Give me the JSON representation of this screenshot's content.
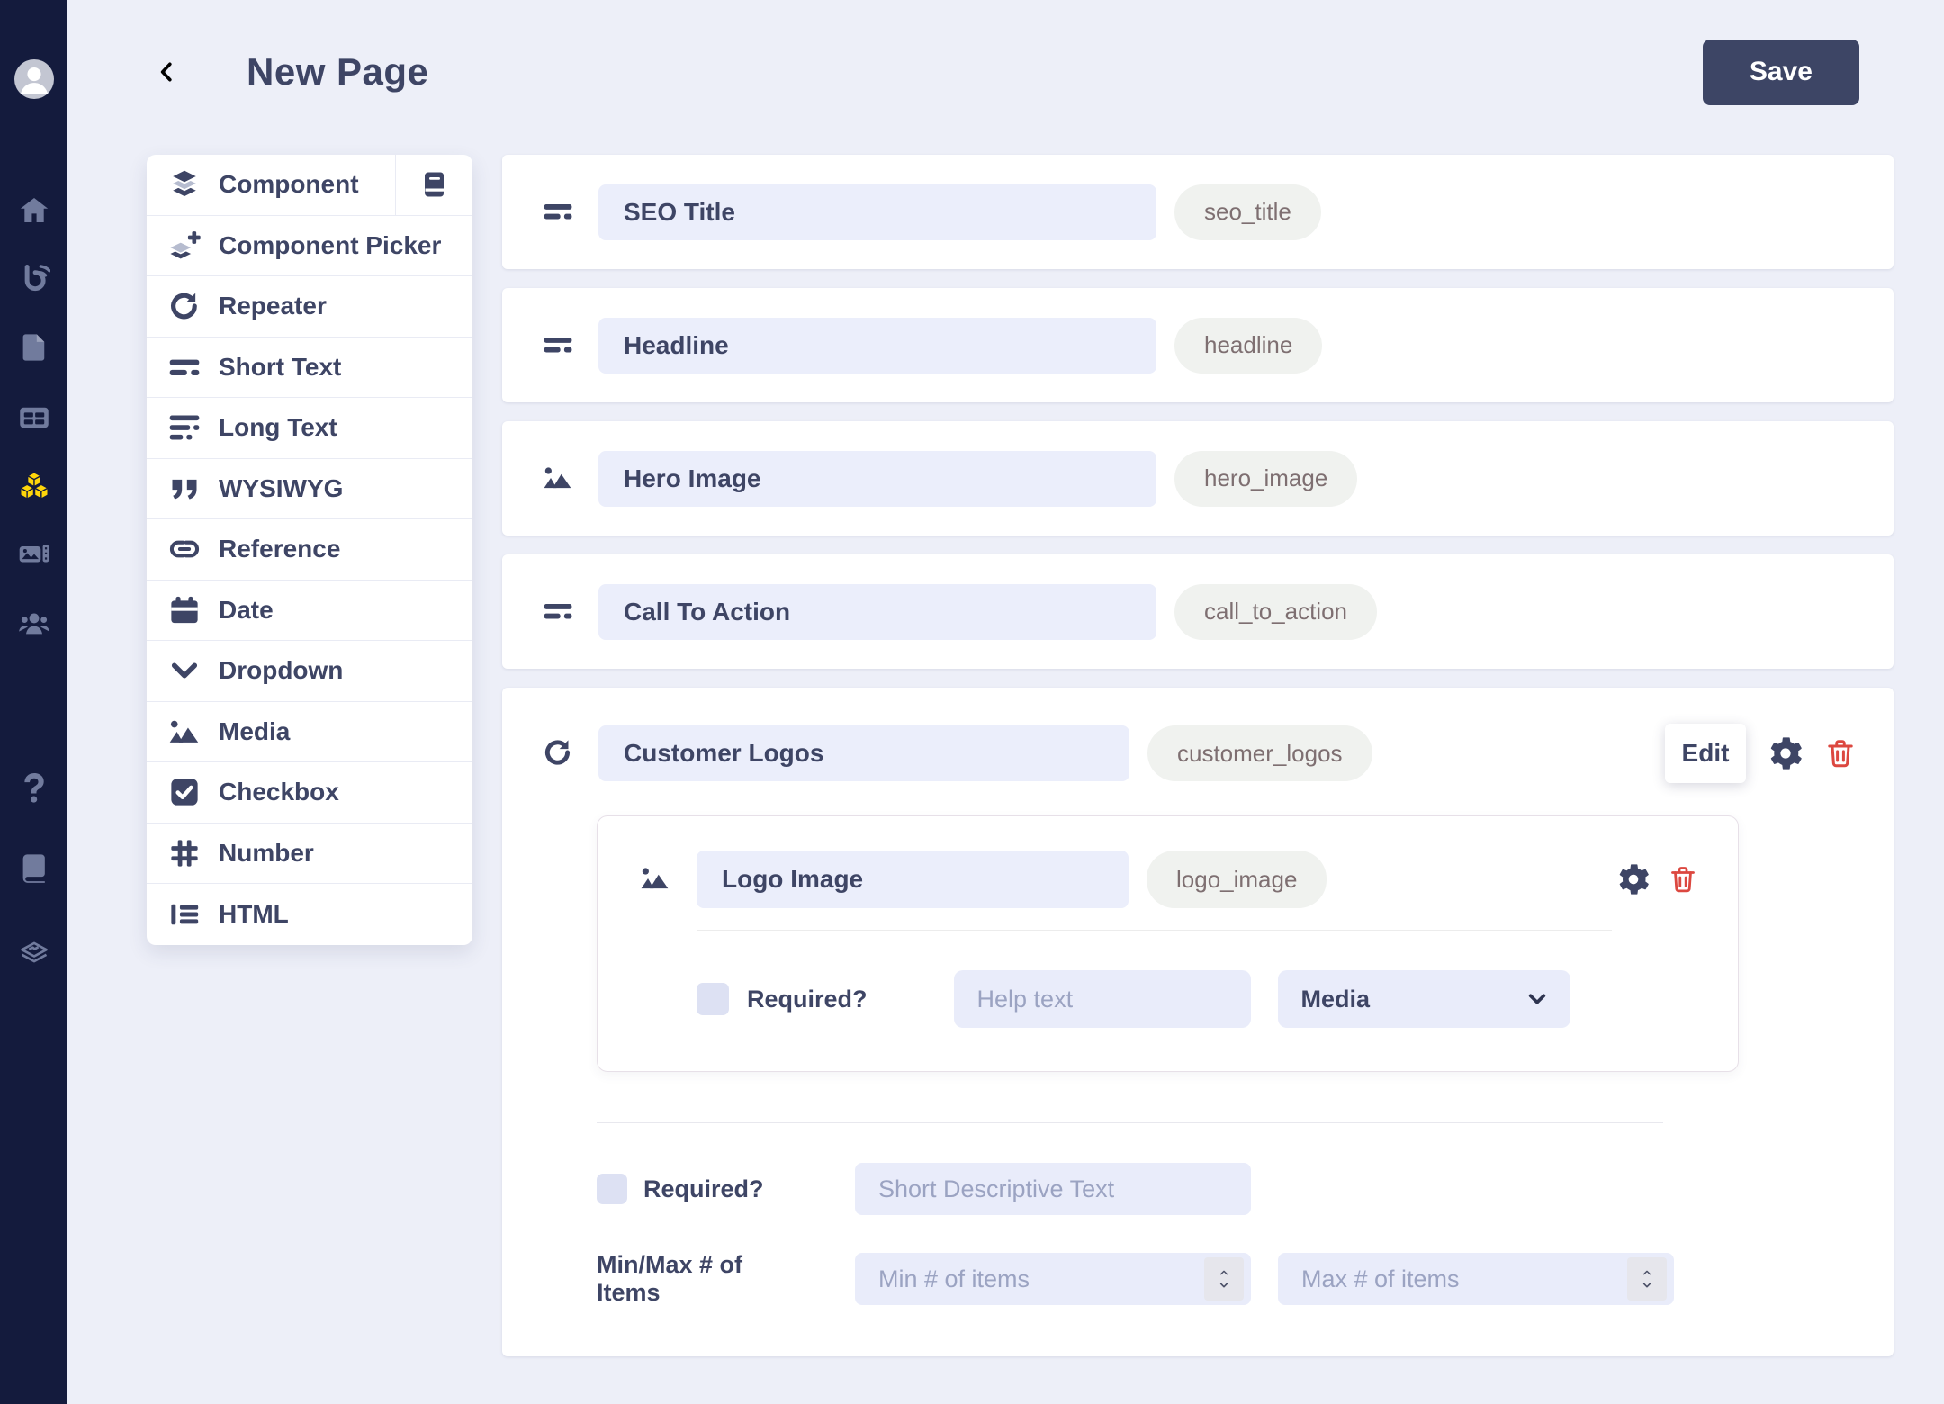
{
  "colors": {
    "accent_yellow": "#FFD60A",
    "sidebar_bg": "#141B3D",
    "primary_dark": "#3E4565",
    "danger_red": "#DC4840",
    "page_bg": "#EDEFF8",
    "input_bg": "#EBEEFB",
    "badge_bg": "#F0F2EF",
    "badge_text": "#7E6F71"
  },
  "header": {
    "title": "New Page",
    "save_label": "Save"
  },
  "sidebar": {
    "items": [
      "avatar",
      "home",
      "blog",
      "pages",
      "collections",
      "components (active)",
      "media-library",
      "users",
      "help",
      "docs",
      "stack"
    ]
  },
  "icons": {
    "avatar-icon": "person silhouette in circle",
    "home-icon": "house",
    "blog-icon": "letter b with broadcast waves",
    "pages-icon": "document with folded corner",
    "collections-icon": "table grid",
    "components-icon": "three stacked cubes (active, yellow)",
    "media-library-icon": "photo with filmstrip",
    "users-icon": "three people",
    "help-icon": "question mark",
    "docs-icon": "book",
    "stack-icon": "layered squares outline",
    "back-icon": "chevron left",
    "doc-book-icon": "book",
    "component-icon": "stacked layers",
    "component-picker-icon": "layers with plus",
    "repeater-icon": "circular rotate arrow",
    "short-text-icon": "two text lines",
    "long-text-icon": "three text lines",
    "wysiwyg-icon": "double quotation marks",
    "reference-icon": "chain link",
    "date-icon": "calendar",
    "dropdown-icon": "chevron down",
    "media-icon": "photo mountains with dot",
    "checkbox-icon": "checked box",
    "number-icon": "hash sign",
    "html-icon": "list lines",
    "gear-icon": "cog",
    "trash-icon": "trash can",
    "chevron-down-icon": "chevron down",
    "spinner-icon": "up and down arrows"
  },
  "panel": {
    "items": [
      {
        "label": "Component",
        "icon": "component",
        "has_doc_icon": true
      },
      {
        "label": "Component Picker",
        "icon": "component-picker"
      },
      {
        "label": "Repeater",
        "icon": "repeater"
      },
      {
        "label": "Short Text",
        "icon": "short-text"
      },
      {
        "label": "Long Text",
        "icon": "long-text"
      },
      {
        "label": "WYSIWYG",
        "icon": "wysiwyg"
      },
      {
        "label": "Reference",
        "icon": "reference"
      },
      {
        "label": "Date",
        "icon": "date"
      },
      {
        "label": "Dropdown",
        "icon": "dropdown"
      },
      {
        "label": "Media",
        "icon": "media"
      },
      {
        "label": "Checkbox",
        "icon": "checkbox"
      },
      {
        "label": "Number",
        "icon": "number"
      },
      {
        "label": "HTML",
        "icon": "html"
      }
    ]
  },
  "fields": [
    {
      "label": "SEO Title",
      "slug": "seo_title",
      "icon": "short-text"
    },
    {
      "label": "Headline",
      "slug": "headline",
      "icon": "short-text"
    },
    {
      "label": "Hero Image",
      "slug": "hero_image",
      "icon": "media"
    },
    {
      "label": "Call To Action",
      "slug": "call_to_action",
      "icon": "short-text"
    }
  ],
  "repeater": {
    "label": "Customer Logos",
    "slug": "customer_logos",
    "icon": "repeater",
    "edit_label": "Edit",
    "nested_field": {
      "label": "Logo Image",
      "slug": "logo_image",
      "icon": "media",
      "required_label": "Required?",
      "help_placeholder": "Help text",
      "type_value": "Media"
    },
    "footer": {
      "required_label": "Required?",
      "description_placeholder": "Short Descriptive Text",
      "minmax_label": "Min/Max # of Items",
      "min_placeholder": "Min # of items",
      "max_placeholder": "Max # of items"
    }
  }
}
